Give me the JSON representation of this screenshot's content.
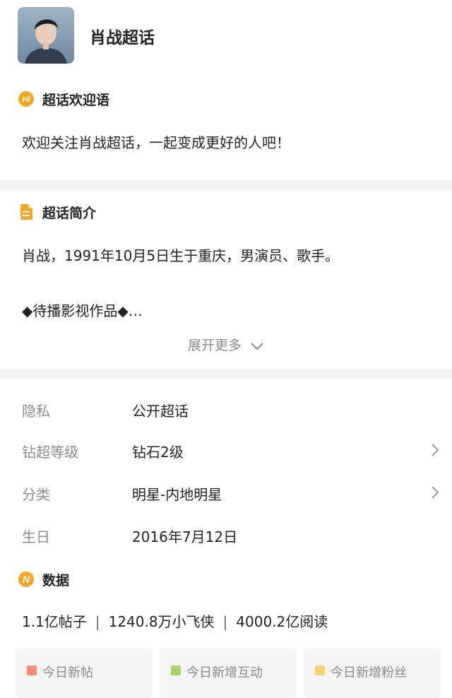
{
  "topic": {
    "name": "肖战超话"
  },
  "welcome": {
    "icon": "hi-badge-icon",
    "title": "超话欢迎语",
    "text": "欢迎关注肖战超话，一起变成更好的人吧！"
  },
  "intro": {
    "icon": "document-icon",
    "title": "超话简介",
    "line1": "肖战，1991年10月5日生于重庆，男演员、歌手。",
    "line2": "◆待播影视作品◆…",
    "expand_label": "展开更多"
  },
  "info_rows": [
    {
      "key": "隐私",
      "value": "公开超话",
      "has_arrow": false
    },
    {
      "key": "钻超等级",
      "value": "钻石2级",
      "has_arrow": true
    },
    {
      "key": "分类",
      "value": "明星-内地明星",
      "has_arrow": true
    },
    {
      "key": "生日",
      "value": "2016年7月12日",
      "has_arrow": false
    }
  ],
  "data_section": {
    "icon": "n-badge-icon",
    "title": "数据",
    "posts": "1.1亿帖子",
    "fans": "1240.8万小飞侠",
    "reads": "4000.2亿阅读",
    "separator": "|"
  },
  "tiles": [
    {
      "label": "今日新帖",
      "color": "#ef8e79"
    },
    {
      "label": "今日新增互动",
      "color": "#a7d468"
    },
    {
      "label": "今日新增粉丝",
      "color": "#f6d277"
    }
  ],
  "colors": {
    "accent_orange": "#f5a623",
    "muted_text": "#8c8c8c",
    "divider": "#f2f2f2"
  }
}
